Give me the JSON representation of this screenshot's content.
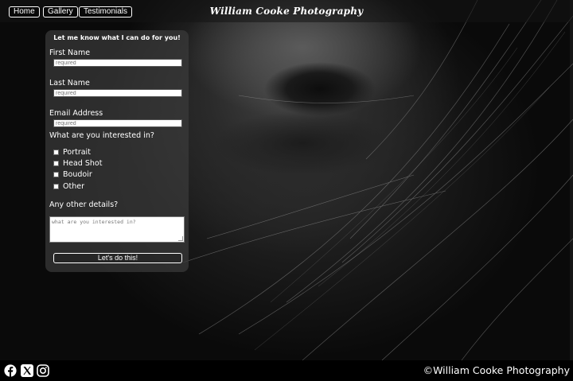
{
  "nav": {
    "home": "Home",
    "gallery": "Gallery",
    "testimonials": "Testimonials",
    "site_title": "William Cooke Photography"
  },
  "form": {
    "heading": "Let me know what I can do for you!",
    "first_name_label": "First Name",
    "first_name_placeholder": "required",
    "last_name_label": "Last Name",
    "last_name_placeholder": "required",
    "email_label": "Email Address",
    "email_placeholder": "required",
    "interest_question": "What are you interested in?",
    "interests": [
      "Portrait",
      "Head Shot",
      "Boudoir",
      "Other"
    ],
    "details_label": "Any other details?",
    "details_placeholder": "what are you interested in?",
    "submit_label": "Let's do this!"
  },
  "footer": {
    "icons": [
      "facebook-icon",
      "x-icon",
      "instagram-icon"
    ],
    "copyright": "©William Cooke Photography"
  }
}
